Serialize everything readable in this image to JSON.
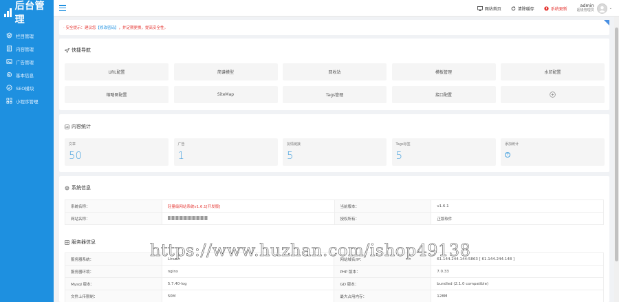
{
  "sidebar": {
    "logo": "后台管理",
    "items": [
      {
        "label": "栏目管理",
        "icon": "layers-icon"
      },
      {
        "label": "内容管理",
        "icon": "document-icon"
      },
      {
        "label": "广告管理",
        "icon": "image-icon"
      },
      {
        "label": "基本信息",
        "icon": "settings-icon"
      },
      {
        "label": "SEO模块",
        "icon": "seo-icon"
      },
      {
        "label": "小程序管理",
        "icon": "grid-icon"
      }
    ]
  },
  "header": {
    "site_home": "网站首页",
    "clear_cache": "清除缓存",
    "system_update": "系统更新",
    "user_name": "admin",
    "user_role": "超级管理员"
  },
  "notice": {
    "prefix": "· 安全提示：建议您",
    "link": "【修改密码】",
    "suffix": "，并定期更换，提高安全性。"
  },
  "quick_nav": {
    "title": "快捷导航",
    "items": [
      "URL配置",
      "简谱模型",
      "回收站",
      "模板管理",
      "水印配置",
      "缩略图配置",
      "SiteMap",
      "Tags管理",
      "接口配置",
      ""
    ]
  },
  "content_stats": {
    "title": "内容统计",
    "items": [
      {
        "label": "文章",
        "value": "50"
      },
      {
        "label": "广告",
        "value": "1"
      },
      {
        "label": "友情链接",
        "value": "5"
      },
      {
        "label": "Tags标签",
        "value": "5"
      },
      {
        "label": "添加统计",
        "value": ""
      }
    ]
  },
  "system_info": {
    "title": "系统信息",
    "rows": [
      [
        "系统名称：",
        "轻量级网站系统v1.6.1[开发版]",
        "当前版本：",
        "v1.6.1"
      ],
      [
        "网站名称：",
        "",
        "授权所有：",
        "正版软件"
      ]
    ]
  },
  "server_info": {
    "title": "服务器信息",
    "rows": [
      [
        "服务器系统：",
        "Linux",
        "网站域名/IP：",
        "61.144.244.144:5863 [ 61.144.244.148 ]"
      ],
      [
        "服务器环境：",
        "nginx",
        "PHP 版本：",
        "7.0.33"
      ],
      [
        "Mysql 版本：",
        "5.7.40-log",
        "GD 版本：",
        "bundled (2.1.0 compatible)"
      ],
      [
        "文件上传限制：",
        "50M",
        "最大占用内存：",
        "128M"
      ]
    ]
  },
  "watermark": "https://www.huzhan.com/ishop49138"
}
